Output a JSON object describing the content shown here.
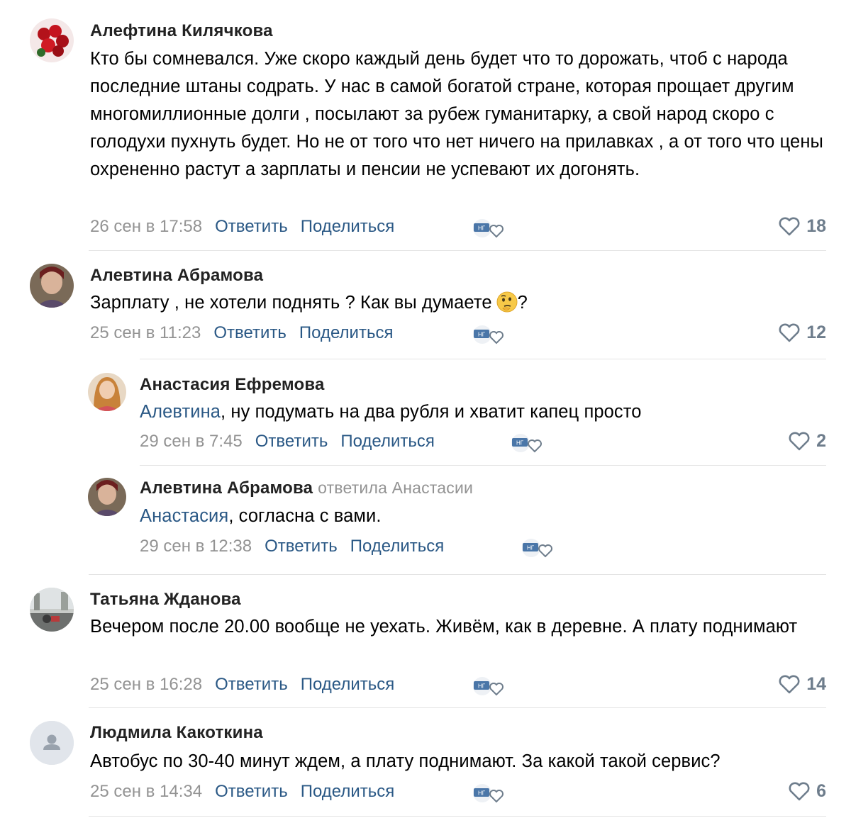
{
  "actions": {
    "reply": "Ответить",
    "share": "Поделиться"
  },
  "badge_text": "НГ",
  "comments": [
    {
      "author": "Алефтина Килячкова",
      "text": "Кто бы сомневался. Уже скоро каждый день будет что то дорожать, чтоб с народа последние штаны содрать. У нас в самой богатой стране, которая прощает другим многомиллионные долги , посылают за рубеж гуманитарку, а свой народ скоро с голодухи пухнуть будет. Но не от того что нет ничего на прилавках , а от того что цены охрененно растут а зарплаты и пенсии не успевают их догонять.",
      "date": "26 сен в 17:58",
      "likes": "18"
    },
    {
      "author": "Алевтина Абрамова",
      "text": "Зарплату , не хотели поднять ? Как вы думаете",
      "text_tail": "?",
      "date": "25 сен в 11:23",
      "likes": "12"
    },
    {
      "author": "Анастасия Ефремова",
      "mention": "Алевтина",
      "text": ", ну подумать на два рубля и хватит капец просто",
      "date": "29 сен в 7:45",
      "likes": "2"
    },
    {
      "author": "Алевтина Абрамова",
      "replied_to": "ответила Анастасии",
      "mention": "Анастасия",
      "text": ", согласна с вами.",
      "date": "29 сен в 12:38",
      "likes": ""
    },
    {
      "author": "Татьяна Жданова",
      "text": "Вечером после 20.00 вообще не уехать. Живём, как в деревне. А плату поднимают",
      "date": "25 сен в 16:28",
      "likes": "14"
    },
    {
      "author": "Людмила Какоткина",
      "text": "Автобус по 30-40 минут ждем, а плату поднимают. За какой такой сервис?",
      "date": "25 сен в 14:34",
      "likes": "6"
    }
  ],
  "colors": {
    "link": "#2a5885",
    "meta": "#939393",
    "likes": "#6e7d8c",
    "divider": "#e3e3e3"
  }
}
